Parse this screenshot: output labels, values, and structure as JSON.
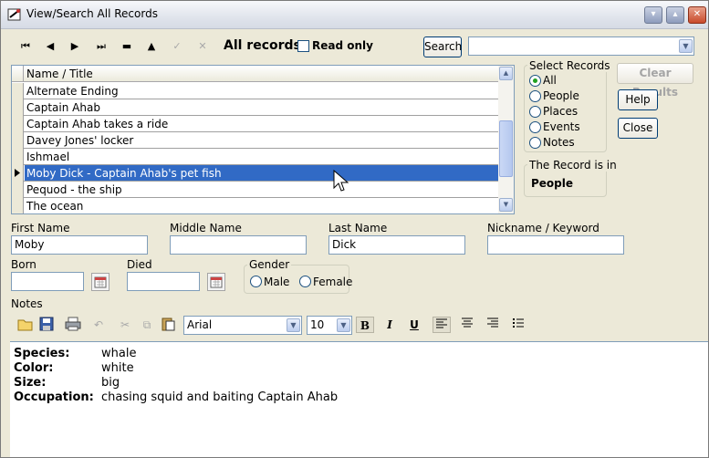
{
  "window": {
    "title": "View/Search All Records"
  },
  "toolbar": {
    "nav_icons": [
      "first-icon",
      "prev-icon",
      "next-icon",
      "last-icon",
      "delete-icon",
      "up-icon",
      "check-icon",
      "cancel-icon"
    ],
    "mode_label": "All records",
    "read_only_label": "Read only",
    "search_label": "Search",
    "search_value": ""
  },
  "grid": {
    "column": "Name / Title",
    "rows": [
      "Alternate Ending",
      "Captain Ahab",
      "Captain Ahab takes a ride",
      "Davey Jones' locker",
      "Ishmael",
      "Moby Dick - Captain Ahab's pet fish",
      "Pequod - the ship",
      "The ocean"
    ],
    "selected_index": 5
  },
  "select_records": {
    "caption": "Select Records",
    "options": [
      "All",
      "People",
      "Places",
      "Events",
      "Notes"
    ],
    "selected": "All"
  },
  "record_in": {
    "caption": "The Record is in",
    "value": "People"
  },
  "buttons": {
    "clear_results": "Clear Results",
    "help": "Help",
    "close": "Close"
  },
  "fields": {
    "first_name": {
      "label": "First Name",
      "value": "Moby"
    },
    "middle_name": {
      "label": "Middle Name",
      "value": ""
    },
    "last_name": {
      "label": "Last Name",
      "value": "Dick"
    },
    "nickname": {
      "label": "Nickname / Keyword",
      "value": ""
    },
    "born": {
      "label": "Born",
      "value": ""
    },
    "died": {
      "label": "Died",
      "value": ""
    }
  },
  "gender": {
    "caption": "Gender",
    "options": [
      "Male",
      "Female"
    ]
  },
  "notes": {
    "label": "Notes",
    "font": "Arial",
    "size": "10",
    "lines": [
      {
        "key": "Species:",
        "value": "whale"
      },
      {
        "key": "Color:",
        "value": "white"
      },
      {
        "key": "Size:",
        "value": "big"
      },
      {
        "key": "Occupation:",
        "value": "chasing squid and baiting Captain Ahab"
      }
    ]
  }
}
